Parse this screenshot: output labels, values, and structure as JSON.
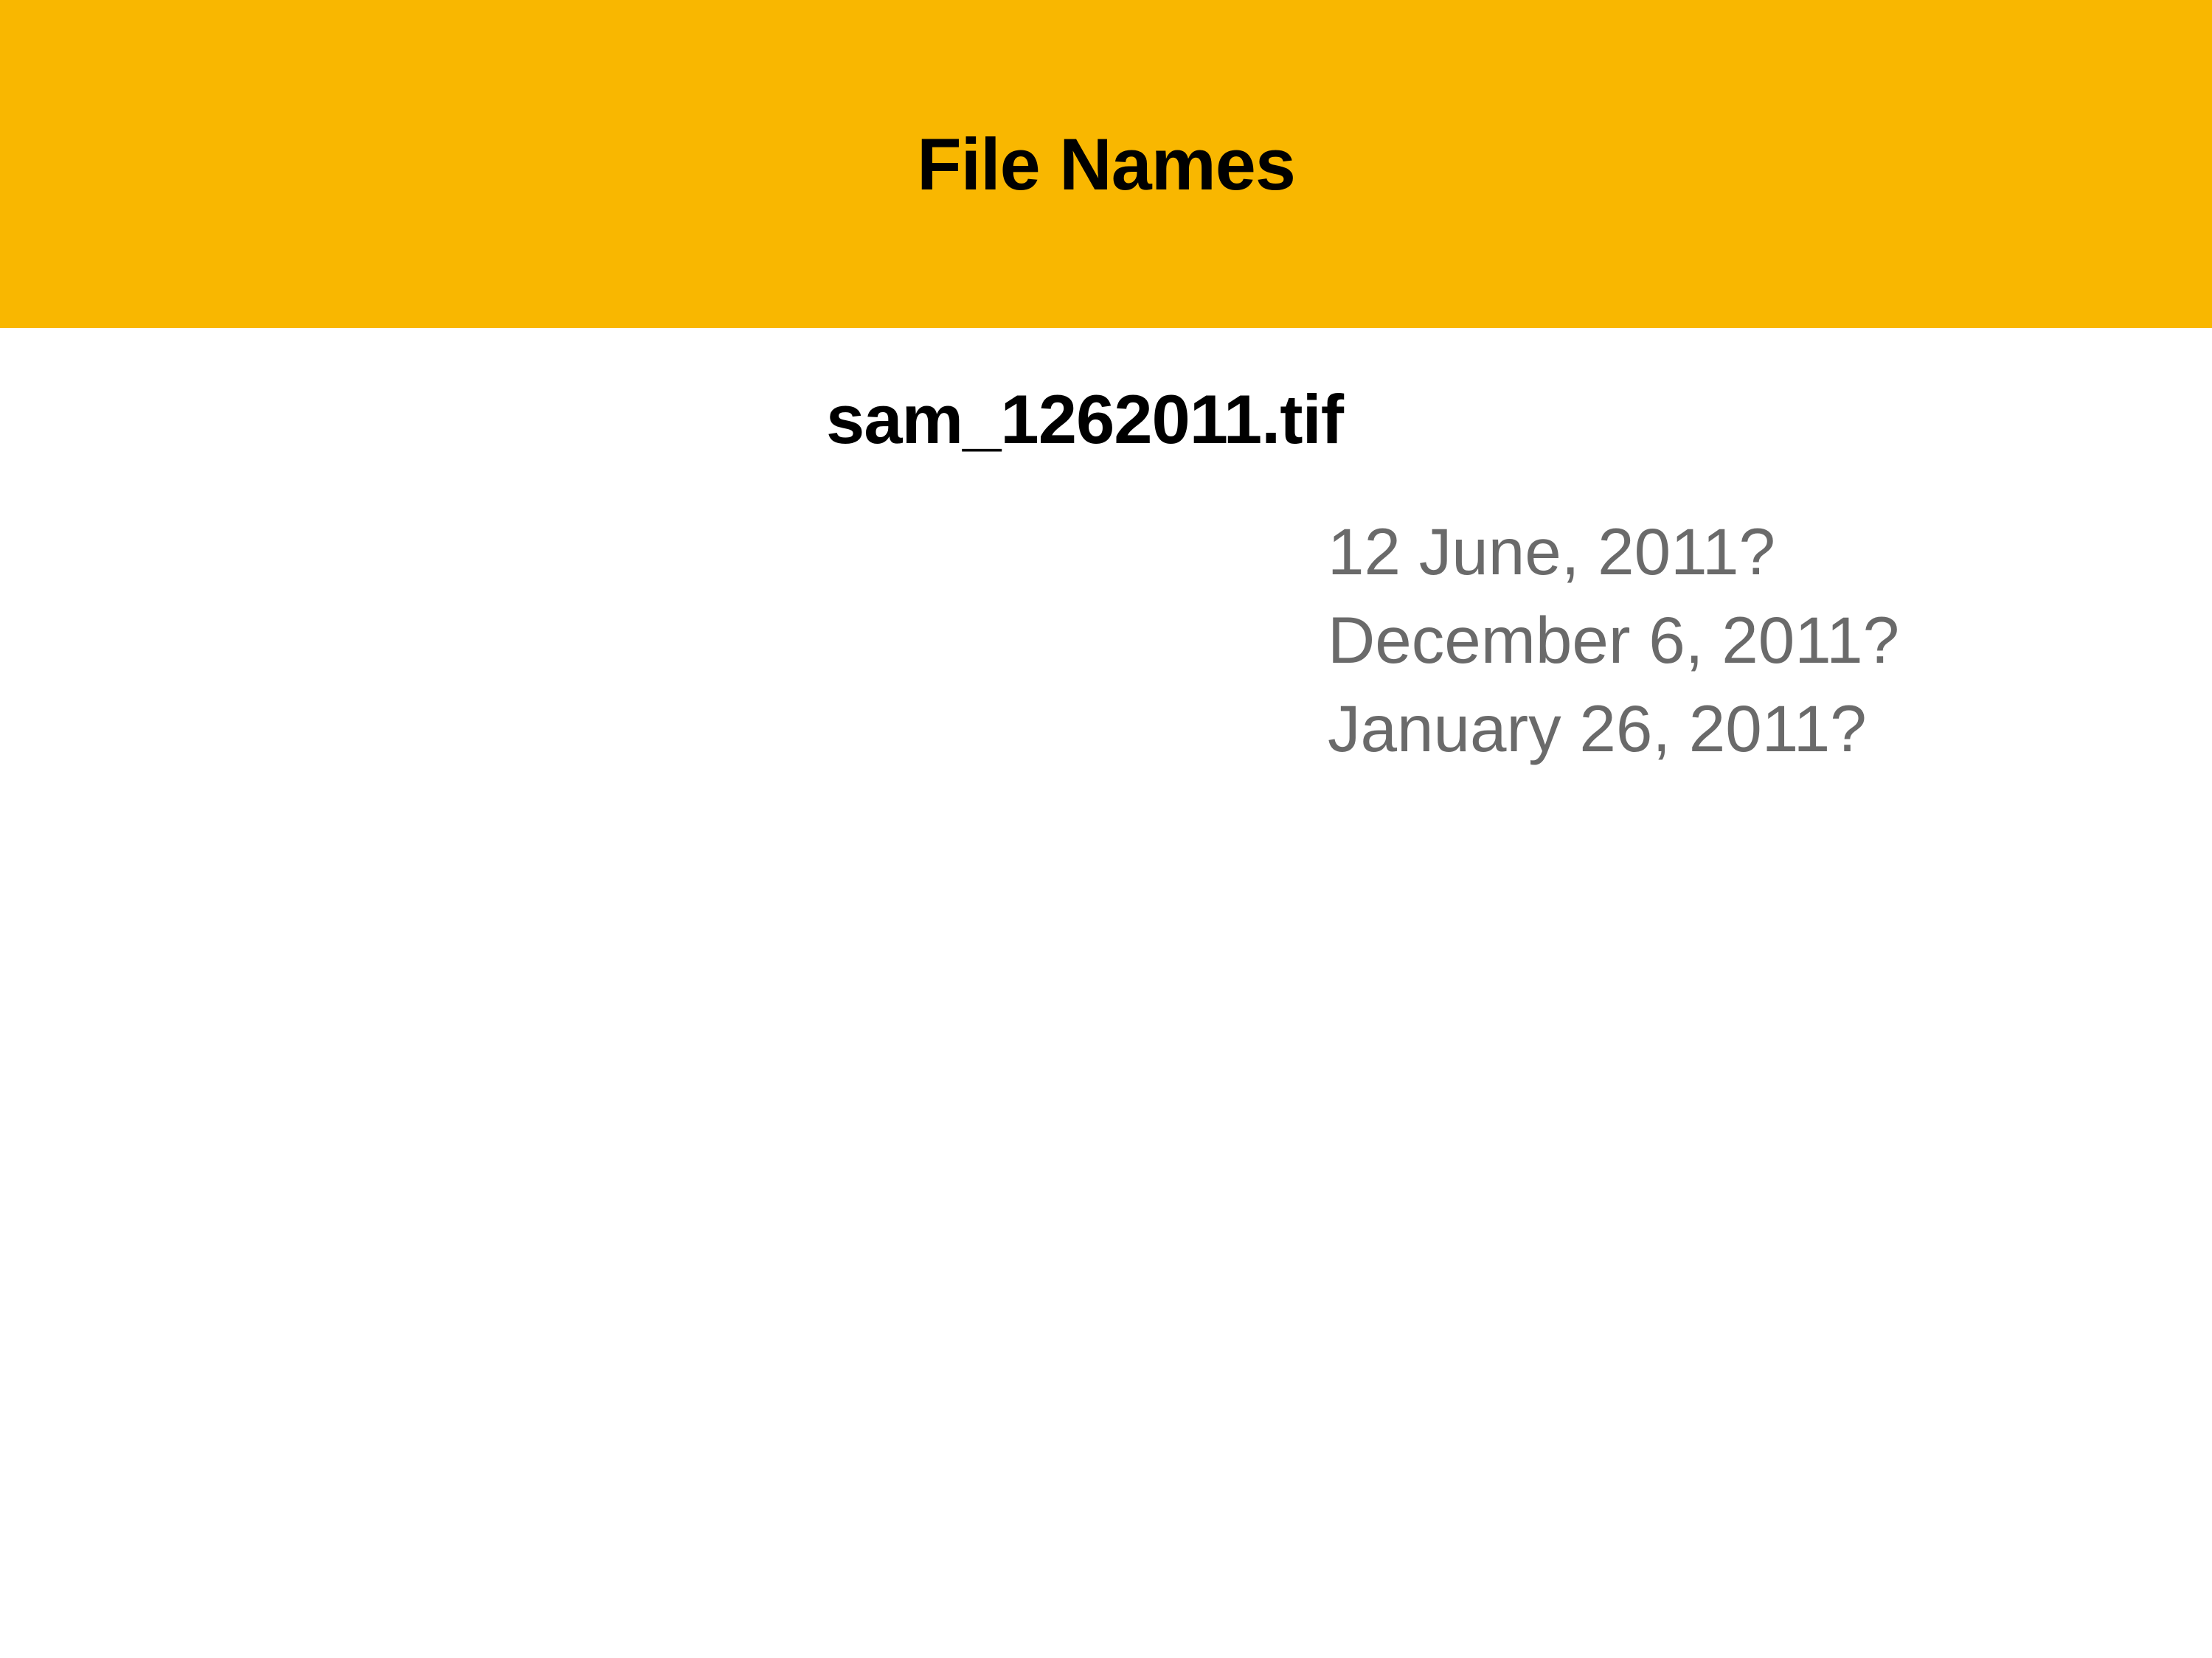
{
  "header": {
    "title": "File Names"
  },
  "content": {
    "filename": "sam_1262011.tif",
    "interpretations": [
      "12 June, 2011?",
      "December 6, 2011?",
      "January 26, 2011?"
    ]
  }
}
